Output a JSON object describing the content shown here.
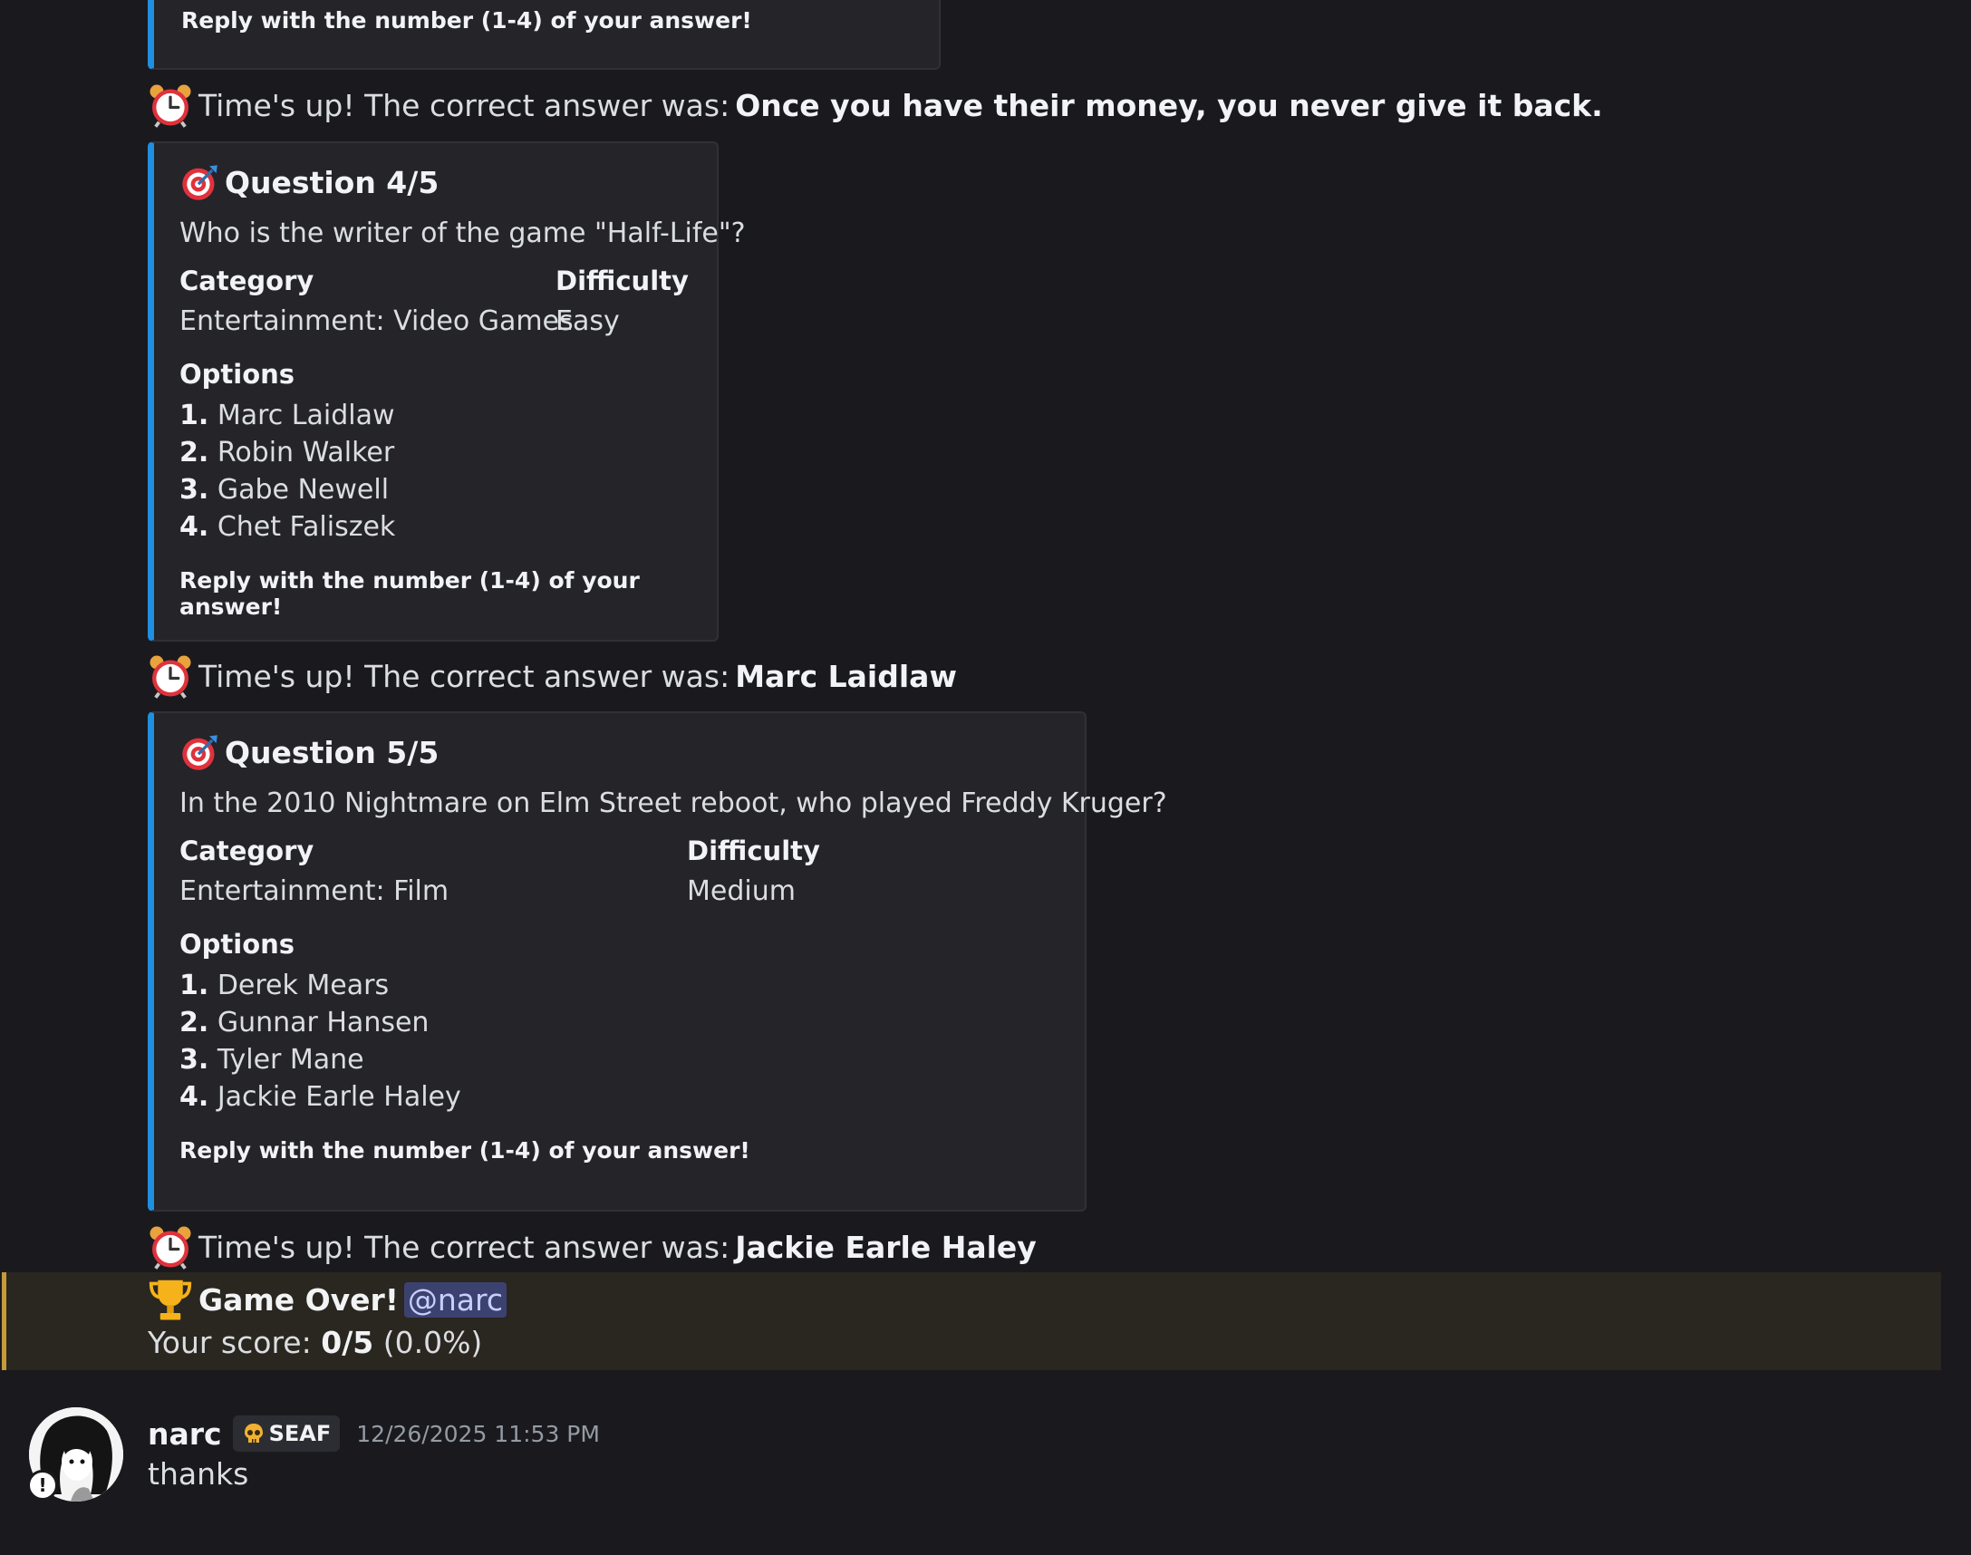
{
  "prev_embed": {
    "footer": "Reply with the number (1-4) of your answer!"
  },
  "timeup_label": "Time's up! The correct answer was:",
  "timeup_answers": [
    "Once you have their money, you never give it back.",
    "Marc Laidlaw",
    "Jackie Earle Haley"
  ],
  "questions": [
    {
      "title": "Question 4/5",
      "text": "Who is the writer of the game \"Half-Life\"?",
      "category_label": "Category",
      "category": "Entertainment: Video Games",
      "difficulty_label": "Difficulty",
      "difficulty": "Easy",
      "options_label": "Options",
      "options": [
        {
          "num": "1.",
          "text": "Marc Laidlaw"
        },
        {
          "num": "2.",
          "text": "Robin Walker"
        },
        {
          "num": "3.",
          "text": "Gabe Newell"
        },
        {
          "num": "4.",
          "text": "Chet Faliszek"
        }
      ],
      "footer": "Reply with the number (1-4) of your answer!"
    },
    {
      "title": "Question 5/5",
      "text": "In the 2010 Nightmare on Elm Street reboot, who played Freddy Kruger?",
      "category_label": "Category",
      "category": "Entertainment: Film",
      "difficulty_label": "Difficulty",
      "difficulty": "Medium",
      "options_label": "Options",
      "options": [
        {
          "num": "1.",
          "text": "Derek Mears"
        },
        {
          "num": "2.",
          "text": "Gunnar Hansen"
        },
        {
          "num": "3.",
          "text": "Tyler Mane"
        },
        {
          "num": "4.",
          "text": "Jackie Earle Haley"
        }
      ],
      "footer": "Reply with the number (1-4) of your answer!"
    }
  ],
  "gameover": {
    "title": "Game Over!",
    "mention": "@narc",
    "score_label": "Your score:",
    "score": "0/5",
    "percent": "(0.0%)"
  },
  "user_message": {
    "username": "narc",
    "tag": "SEAF",
    "timestamp": "12/26/2025 11:53 PM",
    "text": "thanks"
  },
  "icons": {
    "timeup": "alarm-clock-icon",
    "question": "direct-hit-icon",
    "gameover": "trophy-icon",
    "tag": "skull-icon"
  },
  "colors": {
    "background": "#1a1a1e",
    "embed_background": "#242429",
    "embed_accent": "#1f8fe0",
    "highlight_band": "#2a2620",
    "highlight_accent": "#c59a3a",
    "mention": "#3c4270"
  }
}
